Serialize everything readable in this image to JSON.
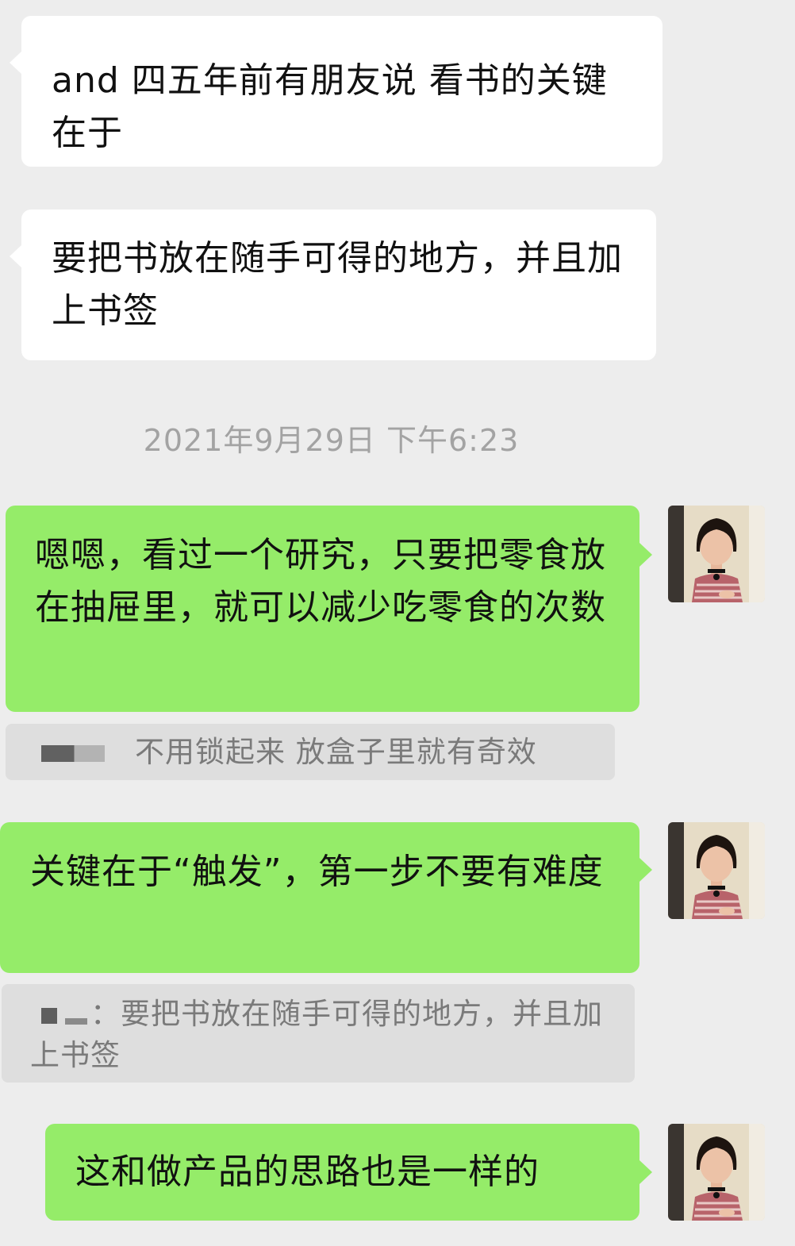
{
  "conversation": {
    "incoming": [
      {
        "text": "and 四五年前有朋友说 看书的关键在于"
      },
      {
        "text": "要把书放在随手可得的地方，并且加上书签"
      }
    ],
    "timestamp": "2021年9月29日 下午6:23",
    "outgoing": [
      {
        "text": "嗯嗯，看过一个研究，只要把零食放在抽屉里，就可以减少吃零食的次数",
        "avatar_icon": "user-avatar-portrait",
        "quote": {
          "sender": "",
          "text": "不用锁起来 放盒子里就有奇效"
        }
      },
      {
        "text": "关键在于“触发”，第一步不要有难度",
        "avatar_icon": "user-avatar-portrait",
        "quote": {
          "sender": "",
          "text": "：要把书放在随手可得的地方，并且加上书签"
        }
      },
      {
        "text": "这和做产品的思路也是一样的",
        "avatar_icon": "user-avatar-portrait"
      }
    ]
  },
  "colors": {
    "background": "#ededed",
    "incoming_bubble": "#ffffff",
    "outgoing_bubble": "#95ec69",
    "quote_background": "#dedede",
    "timestamp_text": "#a3a3a3"
  }
}
